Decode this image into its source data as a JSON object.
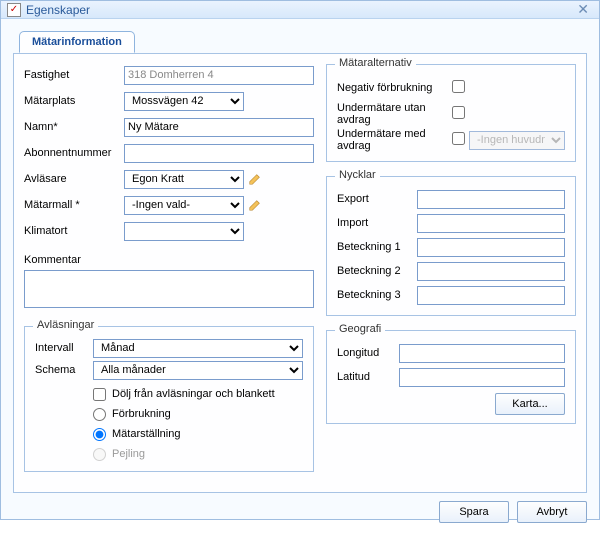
{
  "window": {
    "title": "Egenskaper"
  },
  "tabs": {
    "main": "Mätarinformation"
  },
  "fields": {
    "fastighet_label": "Fastighet",
    "fastighet_value": "318 Domherren 4",
    "matarplats_label": "Mätarplats",
    "matarplats_value": "Mossvägen 42",
    "namn_label": "Namn*",
    "namn_value": "Ny Mätare",
    "abonnent_label": "Abonnentnummer",
    "abonnent_value": "",
    "avlasare_label": "Avläsare",
    "avlasare_value": "Egon Kratt",
    "matarmall_label": "Mätarmall *",
    "matarmall_value": "-Ingen vald-",
    "klimatort_label": "Klimatort",
    "klimatort_value": "",
    "kommentar_label": "Kommentar",
    "kommentar_value": ""
  },
  "alt": {
    "legend": "Mätaralternativ",
    "neg_label": "Negativ förbrukning",
    "under_utan_label": "Undermätare utan avdrag",
    "under_med_label": "Undermätare med avdrag",
    "huvud_value": "-Ingen huvudmätare-"
  },
  "nycklar": {
    "legend": "Nycklar",
    "export_label": "Export",
    "import_label": "Import",
    "bet1_label": "Beteckning 1",
    "bet2_label": "Beteckning 2",
    "bet3_label": "Beteckning 3",
    "export": "",
    "import": "",
    "bet1": "",
    "bet2": "",
    "bet3": ""
  },
  "avl": {
    "legend": "Avläsningar",
    "intervall_label": "Intervall",
    "intervall_value": "Månad",
    "schema_label": "Schema",
    "schema_value": "Alla månader",
    "hide_label": "Dölj från avläsningar och blankett",
    "forbrukning_label": "Förbrukning",
    "matarstallning_label": "Mätarställning",
    "pejling_label": "Pejling"
  },
  "geo": {
    "legend": "Geografi",
    "long_label": "Longitud",
    "lat_label": "Latitud",
    "long": "",
    "lat": "",
    "karta_label": "Karta..."
  },
  "footer": {
    "save": "Spara",
    "cancel": "Avbryt"
  }
}
